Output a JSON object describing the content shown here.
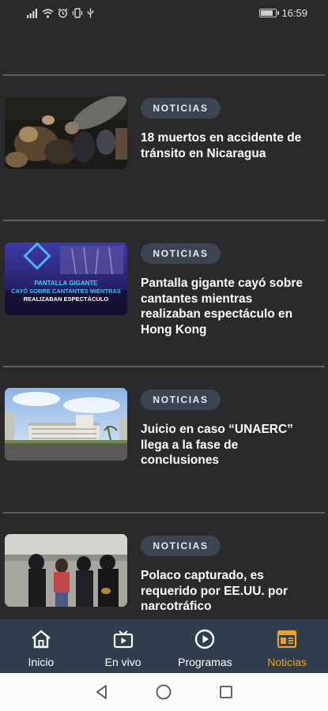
{
  "status_bar": {
    "time": "16:59",
    "battery_level": 0.9
  },
  "feed": {
    "cards": [
      {
        "category": "NOTICIAS",
        "title": "18 muertos en accidente de tránsito en Nicaragua"
      },
      {
        "category": "NOTICIAS",
        "title": "Pantalla gigante cayó sobre cantantes mientras realizaban espectáculo en Hong Kong",
        "thumbnail_caption": [
          "PANTALLA GIGANTE",
          "CAYÓ SOBRE CANTANTES MIENTRAS",
          "REALIZABAN ESPECTÁCULO"
        ]
      },
      {
        "category": "NOTICIAS",
        "title": "Juicio en caso “UNAERC” llega a la fase de conclusiones"
      },
      {
        "category": "NOTICIAS",
        "title": "Polaco capturado, es requerido por EE.UU. por narcotráfico"
      }
    ]
  },
  "bottom_nav": {
    "items": [
      {
        "label": "Inicio",
        "icon": "home-icon"
      },
      {
        "label": "En vivo",
        "icon": "tv-icon"
      },
      {
        "label": "Programas",
        "icon": "play-circle-icon"
      },
      {
        "label": "Noticias",
        "icon": "newspaper-icon",
        "active": true
      }
    ],
    "active_color": "#f0a020",
    "background": "#2f3d4c"
  },
  "system_nav": {
    "buttons": [
      "back-icon",
      "home-circle-icon",
      "recents-icon"
    ]
  }
}
